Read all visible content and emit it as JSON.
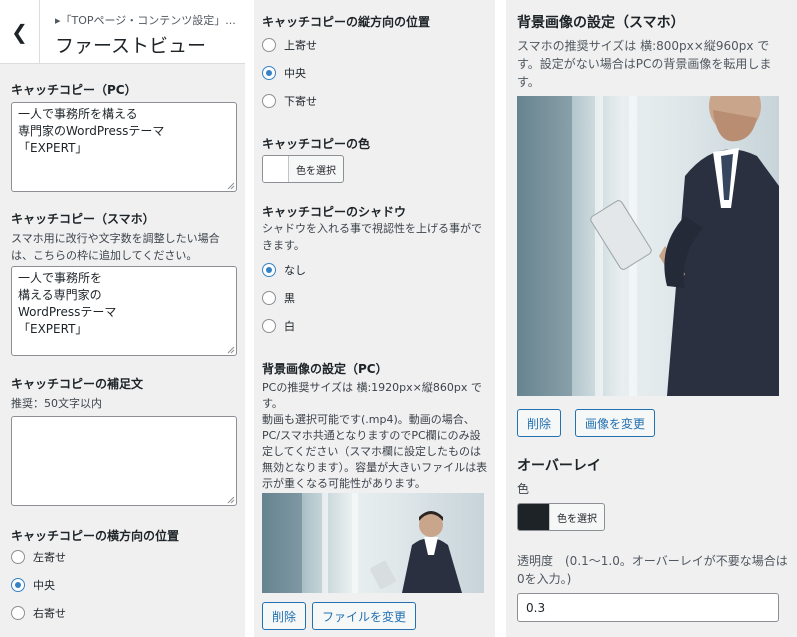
{
  "header": {
    "breadcrumb": "▸「TOPページ・コンテンツ設定」...",
    "title": "ファーストビュー"
  },
  "col1": {
    "catch_pc": {
      "label": "キャッチコピー（PC）",
      "value": "一人で事務所を構える\n専門家のWordPressテーマ\n「EXPERT」"
    },
    "catch_sp": {
      "label": "キャッチコピー（スマホ）",
      "description": "スマホ用に改行や文字数を調整したい場合は、こちらの枠に追加してください。",
      "value": "一人で事務所を\n構える専門家の\nWordPressテーマ\n「EXPERT」"
    },
    "supplement": {
      "label": "キャッチコピーの補足文",
      "description": "推奨：50文字以内",
      "value": ""
    },
    "h_position": {
      "label": "キャッチコピーの横方向の位置",
      "options": [
        "左寄せ",
        "中央",
        "右寄せ"
      ],
      "selected": "中央"
    }
  },
  "col2": {
    "v_position": {
      "label": "キャッチコピーの縦方向の位置",
      "options": [
        "上寄せ",
        "中央",
        "下寄せ"
      ],
      "selected": "中央"
    },
    "color": {
      "label": "キャッチコピーの色",
      "button": "色を選択",
      "swatch": "#ffffff"
    },
    "shadow": {
      "label": "キャッチコピーのシャドウ",
      "description": "シャドウを入れる事で視認性を上げる事ができます。",
      "options": [
        "なし",
        "黒",
        "白"
      ],
      "selected": "なし"
    },
    "bg_pc": {
      "label": "背景画像の設定（PC）",
      "description": "PCの推奨サイズは 横:1920px×縦860px です。\n動画も選択可能です(.mp4)。動画の場合、PC/スマホ共通となりますのでPC欄にのみ設定してください（スマホ欄に設定したものは無効となります）。容量が大きいファイルは表示が重くなる可能性があります。",
      "delete": "削除",
      "change": "ファイルを変更"
    }
  },
  "col3": {
    "bg_sp": {
      "label": "背景画像の設定（スマホ）",
      "description": "スマホの推奨サイズは 横:800px×縦960px です。設定がない場合はPCの背景画像を転用します。",
      "delete": "削除",
      "change": "画像を変更"
    },
    "overlay": {
      "label": "オーバーレイ",
      "color_label": "色",
      "button": "色を選択",
      "swatch": "#1d2327",
      "opacity_label": "透明度　(0.1～1.0。オーバーレイが不要な場合は0を入力。)",
      "opacity_value": "0.3"
    }
  },
  "colors": {
    "accent": "#2271b1",
    "radio": "#3582c4",
    "panel_bg": "#f0f0f1",
    "suit": "#2a3040"
  }
}
